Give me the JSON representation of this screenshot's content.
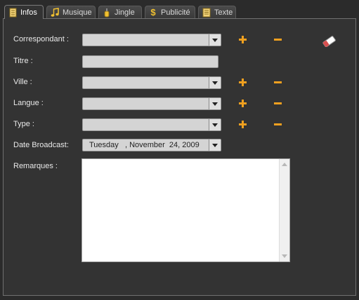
{
  "tabs": [
    {
      "label": "Infos",
      "icon": "document-icon",
      "active": true
    },
    {
      "label": "Musique",
      "icon": "music-note-icon",
      "active": false
    },
    {
      "label": "Jingle",
      "icon": "microphone-icon",
      "active": false
    },
    {
      "label": "Publicité",
      "icon": "dollar-icon",
      "active": false
    },
    {
      "label": "Texte",
      "icon": "text-document-icon",
      "active": false
    }
  ],
  "form": {
    "correspondant_label": "Correspondant :",
    "titre_label": "Titre :",
    "ville_label": "Ville :",
    "langue_label": "Langue :",
    "type_label": "Type :",
    "date_label": "Date Broadcast:",
    "remarques_label": "Remarques :",
    "date_value": "Tuesday   , November  24, 2009",
    "correspondant_value": "",
    "titre_value": "",
    "ville_value": "",
    "langue_value": "",
    "type_value": "",
    "remarques_value": ""
  },
  "colors": {
    "background": "#2b2b2b",
    "panel": "#333333",
    "field": "#d4d4d4",
    "accent": "#f0a020"
  }
}
